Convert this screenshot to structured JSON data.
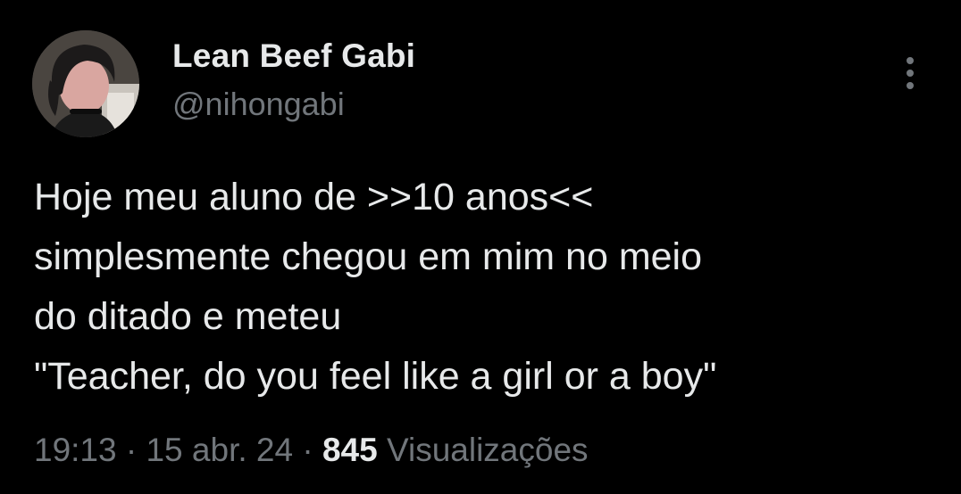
{
  "author": {
    "display_name": "Lean Beef Gabi",
    "handle": "@nihongabi",
    "avatar_icon": "profile-photo"
  },
  "tweet": {
    "lines": [
      "Hoje meu aluno de >>10 anos<<",
      "simplesmente chegou em mim no meio",
      "do ditado e meteu",
      "\"Teacher, do you feel like a girl or a boy\""
    ]
  },
  "meta": {
    "time": "19:13",
    "separator": "·",
    "date": "15 abr. 24",
    "views_count": "845",
    "views_label": "Visualizações"
  },
  "colors": {
    "background": "#000000",
    "primary_text": "#e7e9ea",
    "secondary_text": "#71767b"
  },
  "icons": {
    "more": "more-vertical-icon"
  }
}
